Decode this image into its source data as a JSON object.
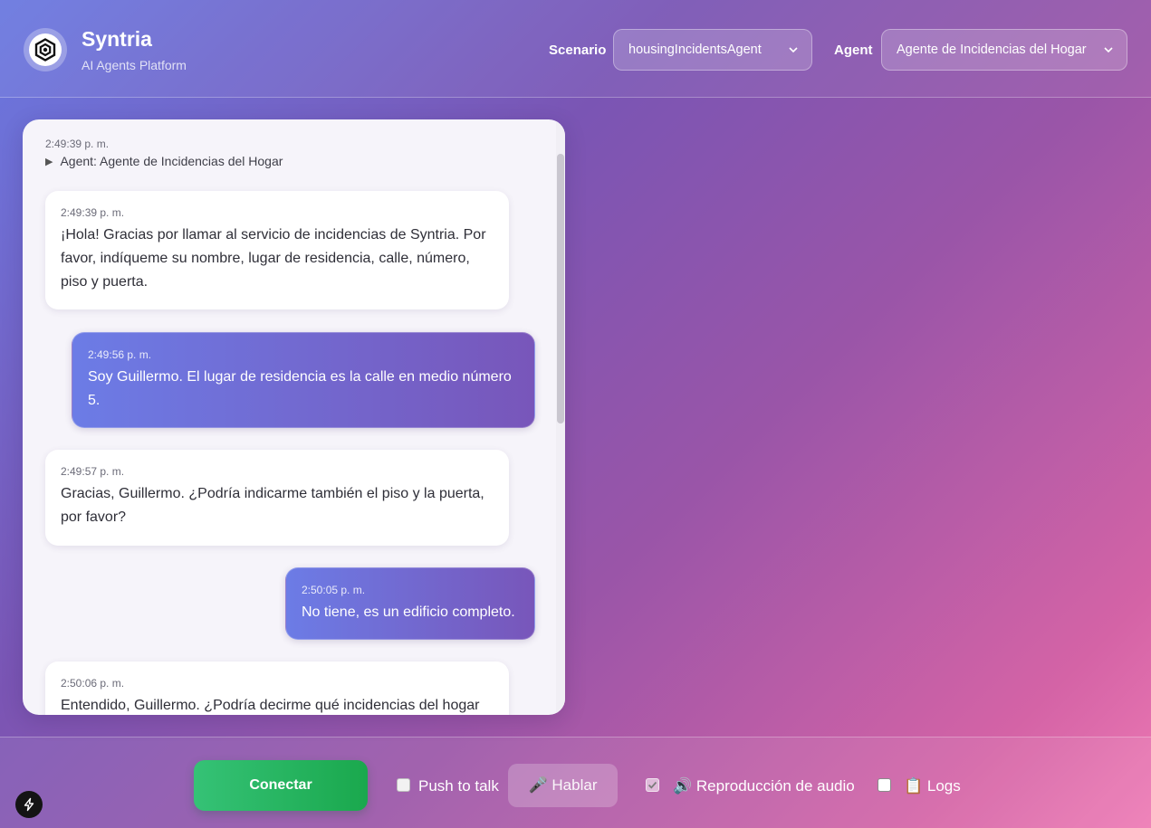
{
  "header": {
    "title": "Syntria",
    "subtitle": "AI Agents Platform",
    "scenario_label": "Scenario",
    "scenario_value": "housingIncidentsAgent",
    "agent_label": "Agent",
    "agent_value": "Agente de Incidencias del Hogar"
  },
  "chat": {
    "system_event": {
      "time": "2:49:39 p. m.",
      "text": "Agent: Agente de Incidencias del Hogar"
    },
    "messages": [
      {
        "role": "agent",
        "time": "2:49:39 p. m.",
        "text": "¡Hola! Gracias por llamar al servicio de incidencias de Syntria. Por favor, indíqueme su nombre, lugar de residencia, calle, número, piso y puerta."
      },
      {
        "role": "user",
        "time": "2:49:56 p. m.",
        "text": "Soy Guillermo. El lugar de residencia es la calle en medio número 5."
      },
      {
        "role": "agent",
        "time": "2:49:57 p. m.",
        "text": "Gracias, Guillermo. ¿Podría indicarme también el piso y la puerta, por favor?"
      },
      {
        "role": "user",
        "time": "2:50:05 p. m.",
        "text": "No tiene, es un edificio completo."
      },
      {
        "role": "agent",
        "time": "2:50:06 p. m.",
        "text": "Entendido, Guillermo. ¿Podría decirme qué incidencias del hogar"
      }
    ]
  },
  "footer": {
    "connect_label": "Conectar",
    "push_to_talk_label": "Push to talk",
    "push_to_talk_checked": false,
    "talk_label": "🎤 Hablar",
    "audio_label": "🔊 Reproducción de audio",
    "audio_checked": true,
    "logs_label": "📋 Logs",
    "logs_checked": false
  },
  "icons": {
    "logo": "hexagon-logo-icon",
    "chevron": "chevron-down-icon",
    "play": "play-triangle-icon",
    "bolt": "lightning-bolt-icon"
  },
  "colors": {
    "connect_green": "#22b35e",
    "user_bubble_start": "#6c7ce6",
    "user_bubble_end": "#7856ba"
  }
}
